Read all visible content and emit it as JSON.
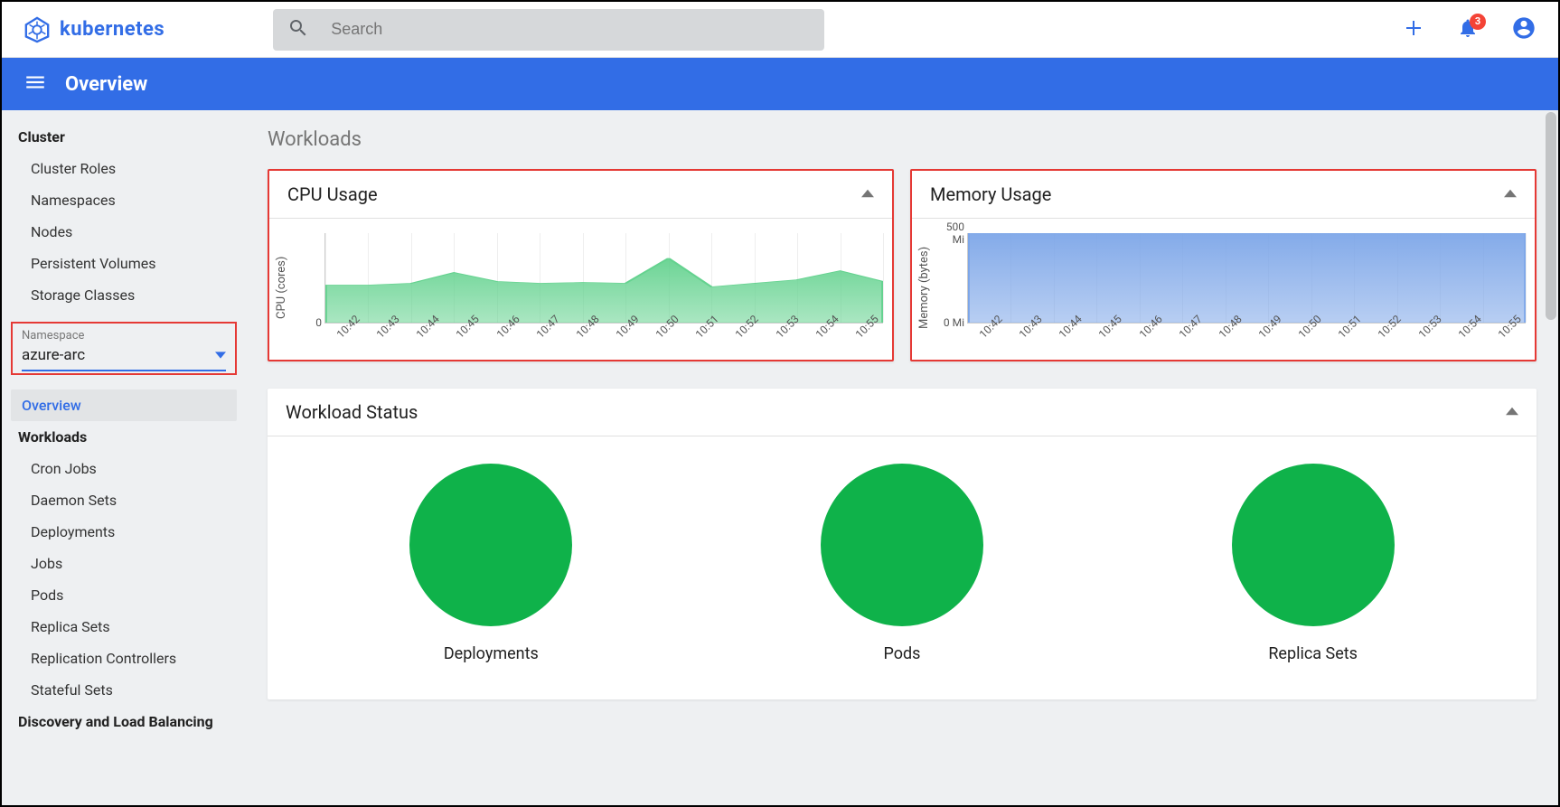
{
  "brand": {
    "name": "kubernetes"
  },
  "search": {
    "placeholder": "Search"
  },
  "notifications": {
    "count": "3"
  },
  "bluebar": {
    "title": "Overview"
  },
  "sidebar": {
    "cluster_label": "Cluster",
    "cluster_items": [
      "Cluster Roles",
      "Namespaces",
      "Nodes",
      "Persistent Volumes",
      "Storage Classes"
    ],
    "namespace_label": "Namespace",
    "namespace_value": "azure-arc",
    "overview": "Overview",
    "workloads_label": "Workloads",
    "workloads_items": [
      "Cron Jobs",
      "Daemon Sets",
      "Deployments",
      "Jobs",
      "Pods",
      "Replica Sets",
      "Replication Controllers",
      "Stateful Sets"
    ],
    "discovery_label": "Discovery and Load Balancing"
  },
  "main": {
    "section_title": "Workloads",
    "cpu_card_title": "CPU Usage",
    "cpu_y_label": "CPU (cores)",
    "mem_card_title": "Memory Usage",
    "mem_y_label": "Memory (bytes)",
    "status_title": "Workload Status",
    "status_items": [
      "Deployments",
      "Pods",
      "Replica Sets"
    ]
  },
  "chart_data": [
    {
      "type": "area",
      "title": "CPU Usage",
      "ylabel": "CPU (cores)",
      "x": [
        "10:42",
        "10:43",
        "10:44",
        "10:45",
        "10:46",
        "10:47",
        "10:48",
        "10:49",
        "10:50",
        "10:51",
        "10:52",
        "10:53",
        "10:54",
        "10:55"
      ],
      "y_ticks": [
        "0"
      ],
      "ylim": [
        0,
        1
      ],
      "series": [
        {
          "name": "cpu",
          "values": [
            0.42,
            0.42,
            0.44,
            0.56,
            0.46,
            0.44,
            0.45,
            0.44,
            0.72,
            0.4,
            0.44,
            0.48,
            0.58,
            0.46
          ]
        }
      ],
      "color": "#64d28f"
    },
    {
      "type": "area",
      "title": "Memory Usage",
      "ylabel": "Memory (bytes)",
      "x": [
        "10:42",
        "10:43",
        "10:44",
        "10:45",
        "10:46",
        "10:47",
        "10:48",
        "10:49",
        "10:50",
        "10:51",
        "10:52",
        "10:53",
        "10:54",
        "10:55"
      ],
      "y_ticks": [
        "0 Mi",
        "500 Mi"
      ],
      "ylim": [
        0,
        500
      ],
      "series": [
        {
          "name": "memory",
          "values": [
            500,
            500,
            500,
            500,
            500,
            500,
            500,
            500,
            500,
            500,
            500,
            500,
            500,
            500
          ]
        }
      ],
      "color": "#7da6e8"
    }
  ]
}
